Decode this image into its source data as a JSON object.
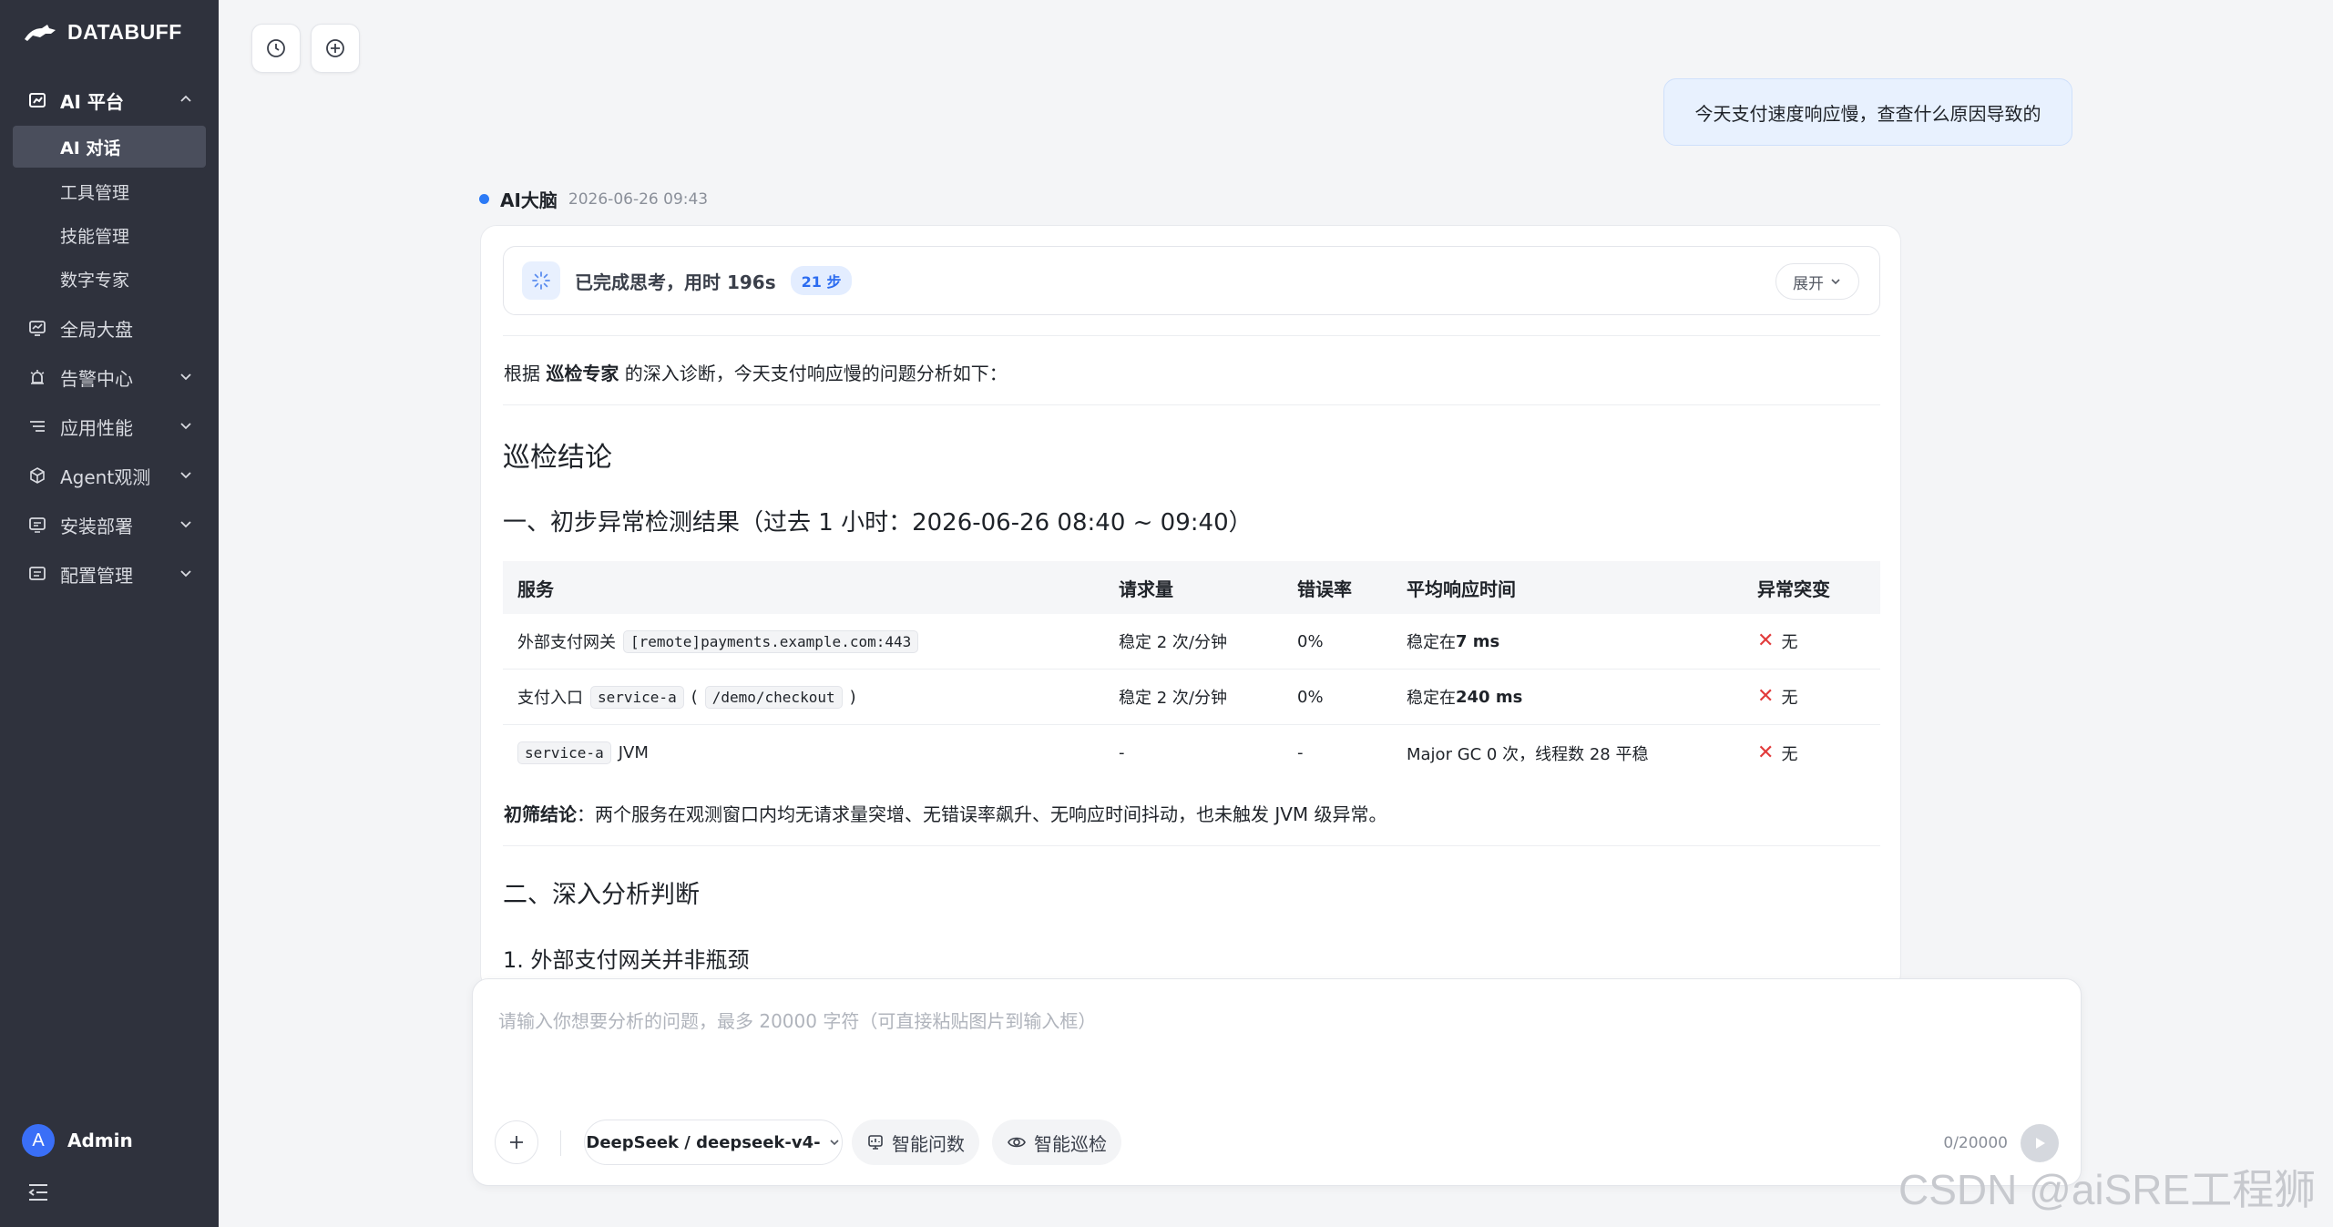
{
  "brand": {
    "name": "DATABUFF"
  },
  "sidebar": {
    "groups": [
      {
        "label": "AI 平台"
      },
      {
        "label": "全局大盘"
      },
      {
        "label": "告警中心"
      },
      {
        "label": "应用性能"
      },
      {
        "label": "Agent观测"
      },
      {
        "label": "安装部署"
      },
      {
        "label": "配置管理"
      }
    ],
    "ai_sub": [
      {
        "label": "AI 对话"
      },
      {
        "label": "工具管理"
      },
      {
        "label": "技能管理"
      },
      {
        "label": "数字专家"
      }
    ],
    "active_item": "AI 对话"
  },
  "user": {
    "avatar_letter": "A",
    "name": "Admin"
  },
  "chat": {
    "user_message": "今天支付速度响应慢，查查什么原因导致的",
    "ai_name": "AI大脑",
    "ai_time": "2026-06-26 09:43",
    "thinking": {
      "text": "已完成思考，用时 196s",
      "steps": "21 步",
      "expand_label": "展开"
    },
    "intro": {
      "pre": "根据 ",
      "bold": "巡检专家",
      "post": " 的深入诊断，今天支付响应慢的问题分析如下："
    },
    "heading_main": "巡检结论",
    "heading_1": "一、初步异常检测结果（过去 1 小时：2026-06-26 08:40 ~ 09:40）",
    "table": {
      "headers": [
        "服务",
        "请求量",
        "错误率",
        "平均响应时间",
        "异常突变"
      ],
      "rows": [
        {
          "svc_text": "外部支付网关",
          "svc_code": "[remote]payments.example.com:443",
          "req": "稳定 2 次/分钟",
          "err": "0%",
          "avg_pre": "稳定在 ",
          "avg_bold": "7 ms",
          "anomaly": "无"
        },
        {
          "svc_text": "支付入口",
          "svc_code": "service-a",
          "svc_paren_open": "(",
          "svc_code2": "/demo/checkout",
          "svc_paren_close": ")",
          "req": "稳定 2 次/分钟",
          "err": "0%",
          "avg_pre": "稳定在 ",
          "avg_bold": "240 ms",
          "anomaly": "无"
        },
        {
          "svc_code": "service-a",
          "svc_text": "JVM",
          "req": "-",
          "err": "-",
          "avg_pre": "Major GC 0 次，线程数 28 平稳",
          "anomaly": "无"
        }
      ],
      "anomaly_icon": "cross-icon"
    },
    "verdict": {
      "bold": "初筛结论",
      "text": "：两个服务在观测窗口内均无请求量突增、无错误率飙升、无响应时间抖动，也未触发 JVM 级异常。"
    },
    "heading_2": "二、深入分析判断",
    "heading_3": "1. 外部支付网关并非瓶颈"
  },
  "composer": {
    "placeholder": "请输入你想要分析的问题，最多 20000 字符（可直接粘贴图片到输入框）",
    "model": "DeepSeek / deepseek-v4-",
    "chip_1": "智能问数",
    "chip_2": "智能巡检",
    "counter": "0/20000"
  },
  "watermark": "CSDN @aiSRE工程狮",
  "colors": {
    "sidebar_bg": "#2f323d",
    "accent": "#2c7af6",
    "user_bubble": "#e8f1fe",
    "cross": "#e23b3b"
  }
}
